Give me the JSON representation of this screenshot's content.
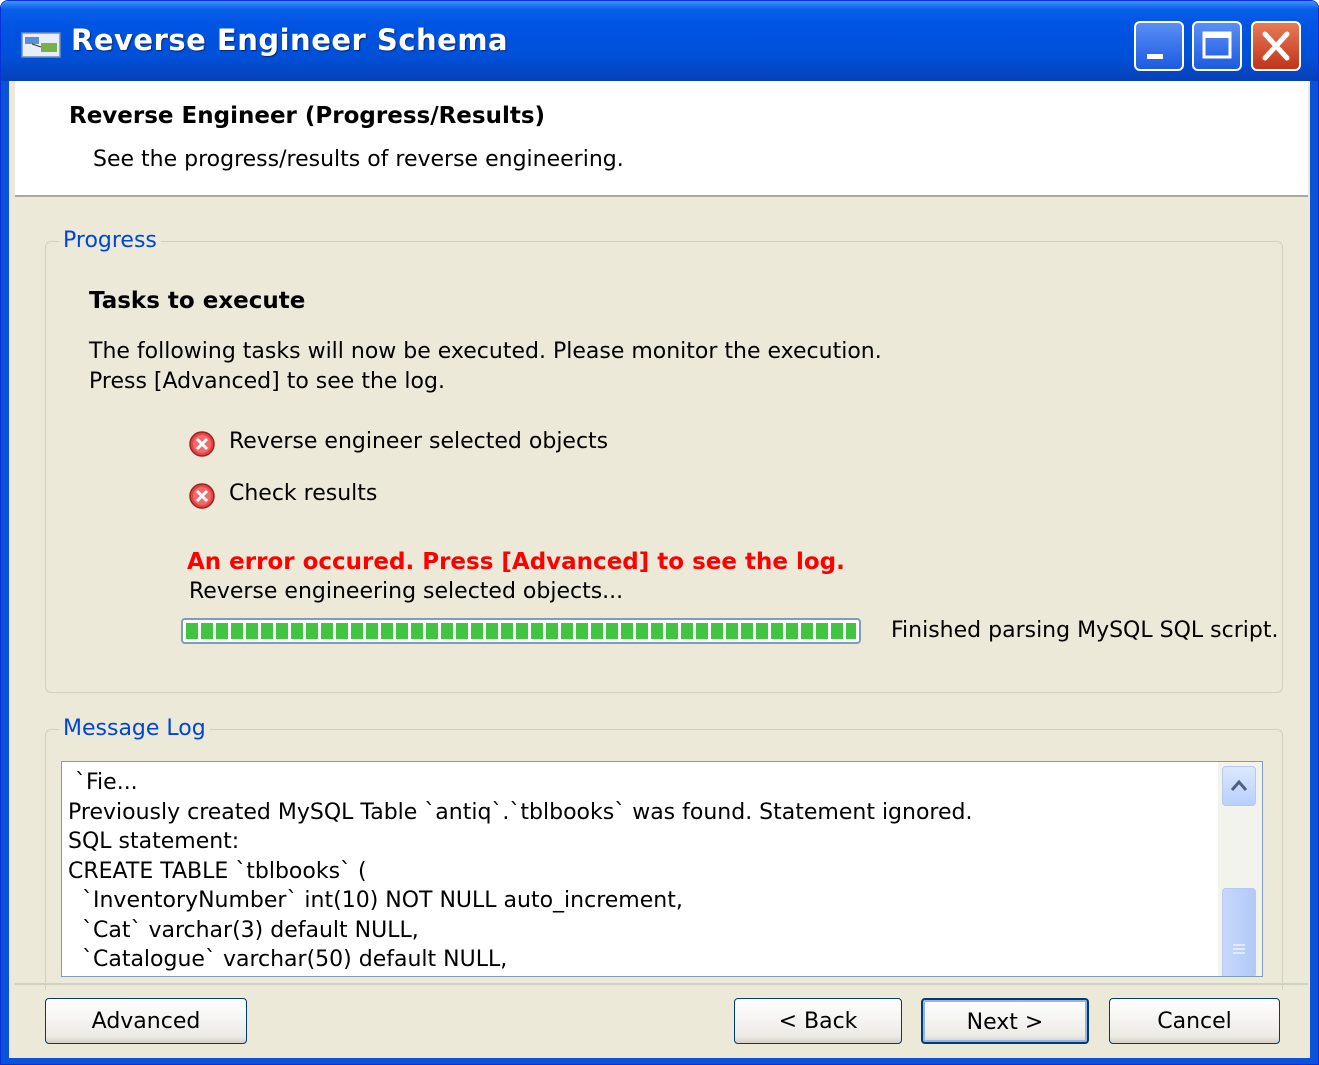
{
  "window": {
    "title": "Reverse Engineer Schema"
  },
  "header": {
    "title": "Reverse Engineer (Progress/Results)",
    "subtitle": "See the progress/results of reverse engineering."
  },
  "progress_group": {
    "label": "Progress",
    "heading": "Tasks to execute",
    "description_line1": "The following tasks will now be executed. Please monitor the execution.",
    "description_line2": "Press [Advanced] to see the log.",
    "tasks": [
      {
        "label": "Reverse engineer selected objects",
        "status_icon": "error-icon"
      },
      {
        "label": "Check results",
        "status_icon": "error-icon"
      }
    ],
    "error_message": "An error occured. Press [Advanced] to see the log.",
    "current_task": "Reverse engineering selected objects...",
    "progress_percent": 100,
    "progress_status": "Finished parsing MySQL SQL script."
  },
  "message_log": {
    "label": "Message Log",
    "lines": [
      " `Fie...",
      "Previously created MySQL Table `antiq`.`tblbooks` was found. Statement ignored.",
      "SQL statement:",
      "CREATE TABLE `tblbooks` (",
      "  `InventoryNumber` int(10) NOT NULL auto_increment,",
      "  `Cat` varchar(3) default NULL,",
      "  `Catalogue` varchar(50) default NULL,"
    ]
  },
  "buttons": {
    "advanced": "Advanced",
    "back": "< Back",
    "next": "Next >",
    "cancel": "Cancel"
  },
  "colors": {
    "title_bar": "#0054e3",
    "error_text": "#ff0000",
    "group_label": "#0046d5",
    "progress_fill": "#3fc53f"
  }
}
